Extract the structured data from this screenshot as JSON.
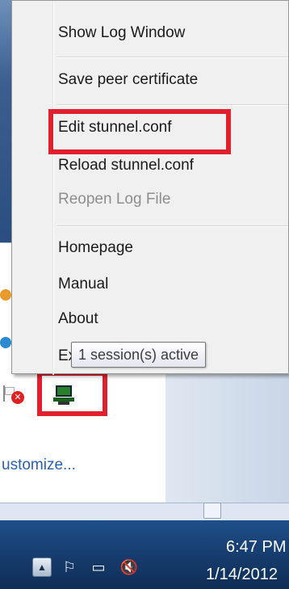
{
  "context_menu": {
    "items": [
      {
        "label": "Show Log Window",
        "enabled": true
      },
      {
        "label": "Save peer certificate",
        "enabled": true
      },
      {
        "label": "Edit stunnel.conf",
        "enabled": true,
        "highlighted": true
      },
      {
        "label": "Reload stunnel.conf",
        "enabled": true
      },
      {
        "label": "Reopen Log File",
        "enabled": false
      },
      {
        "label": "Homepage",
        "enabled": true
      },
      {
        "label": "Manual",
        "enabled": true
      },
      {
        "label": "About",
        "enabled": true
      },
      {
        "label": "Exit",
        "enabled": true
      }
    ]
  },
  "tooltip": {
    "text": "1 session(s) active"
  },
  "overflow_panel": {
    "customize_link": "ustomize..."
  },
  "taskbar": {
    "clock_time": "6:47 PM",
    "clock_date": "1/14/2012"
  },
  "icons": {
    "tray_app": "stunnel-monitor-icon",
    "show_hidden": "chevron-up-icon"
  },
  "colors": {
    "highlight": "#e0202c",
    "taskbar": "#163d6f",
    "link": "#2a5fb0"
  }
}
